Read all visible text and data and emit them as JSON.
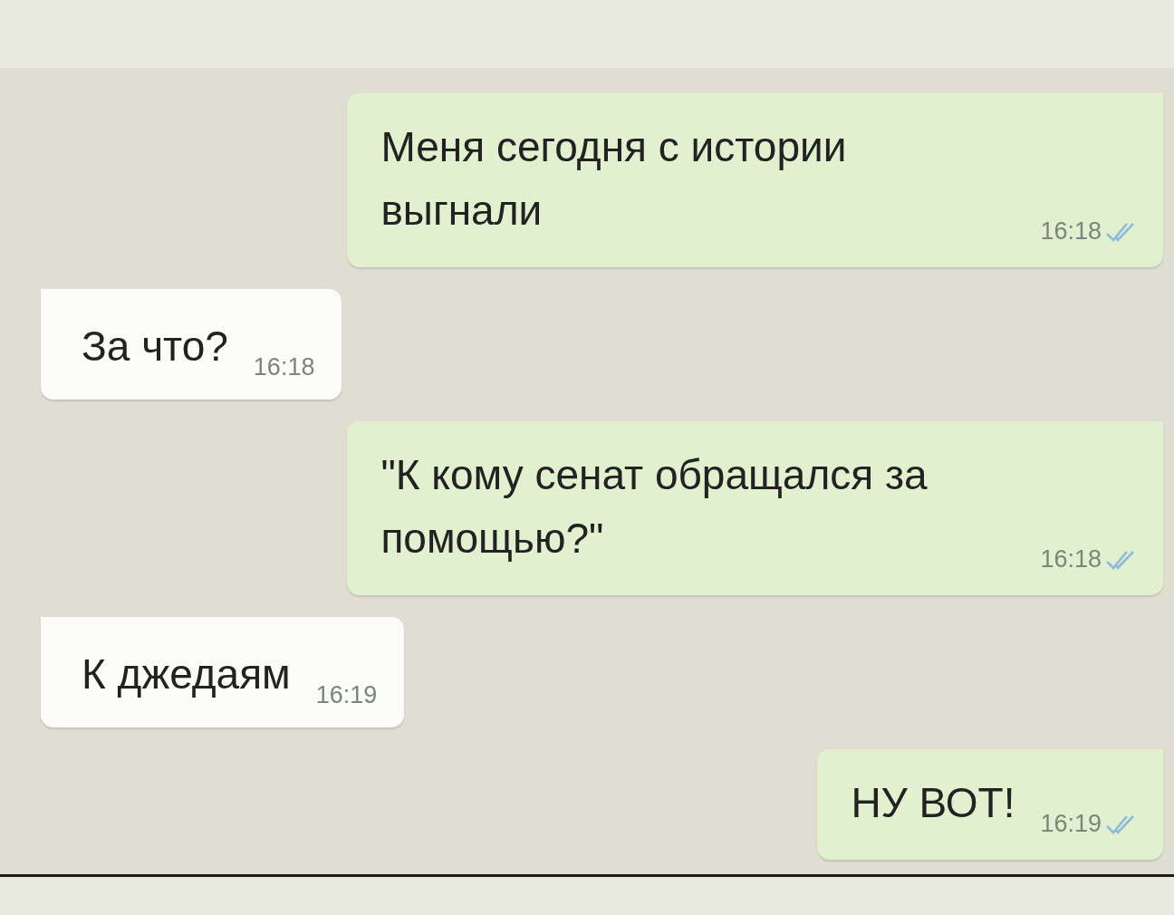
{
  "messages": [
    {
      "kind": "outgoing",
      "text": "Меня сегодня с истории выгнали",
      "time": "16:18",
      "read": true
    },
    {
      "kind": "incoming",
      "text": "За что?",
      "time": "16:18"
    },
    {
      "kind": "outgoing",
      "text": "\"К кому сенат обращался за помощью?\"",
      "time": "16:18",
      "read": true
    },
    {
      "kind": "incoming",
      "text": "К джедаям",
      "time": "16:19"
    },
    {
      "kind": "outgoing",
      "text": "НУ ВОТ!",
      "time": "16:19",
      "read": true
    }
  ]
}
